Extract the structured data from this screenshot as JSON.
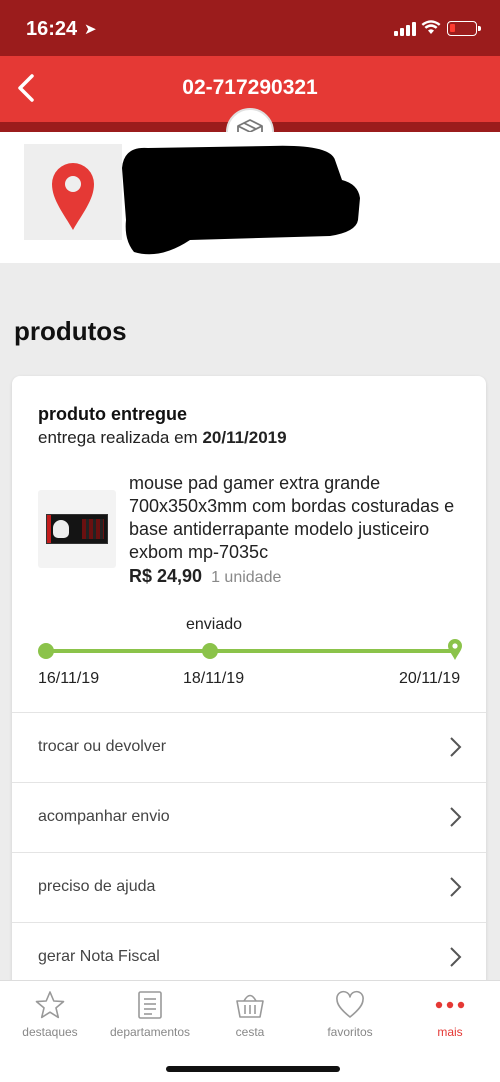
{
  "status_bar": {
    "time": "16:24",
    "location_arrow": "location-arrow-icon"
  },
  "header": {
    "title": "02-717290321",
    "back_icon": "chevron-left-icon",
    "badge_icon": "box-icon"
  },
  "address": {
    "icon": "map-pin-icon"
  },
  "section": {
    "title": "produtos"
  },
  "order": {
    "status_title": "produto entregue",
    "status_prefix": "entrega realizada em ",
    "status_date": "20/11/2019",
    "product": {
      "name": "mouse pad gamer extra grande 700x350x3mm com bordas costuradas e base antiderrapante modelo justiceiro exbom mp-7035c",
      "price": "R$ 24,90",
      "quantity": "1 unidade"
    },
    "tracking": {
      "label": "enviado",
      "dates": [
        "16/11/19",
        "18/11/19",
        "20/11/19"
      ],
      "color": "#8bc34a"
    },
    "actions": [
      {
        "label": "trocar ou devolver"
      },
      {
        "label": "acompanhar envio"
      },
      {
        "label": "preciso de ajuda"
      },
      {
        "label": "gerar Nota Fiscal"
      }
    ]
  },
  "tabs": [
    {
      "label": "destaques",
      "icon": "star-icon"
    },
    {
      "label": "departamentos",
      "icon": "list-icon"
    },
    {
      "label": "cesta",
      "icon": "basket-icon"
    },
    {
      "label": "favoritos",
      "icon": "heart-icon"
    },
    {
      "label": "mais",
      "icon": "more-icon",
      "active": true
    }
  ],
  "colors": {
    "brand_red": "#e53935",
    "dark_red": "#9b1c1c",
    "tracking_green": "#8bc34a"
  }
}
